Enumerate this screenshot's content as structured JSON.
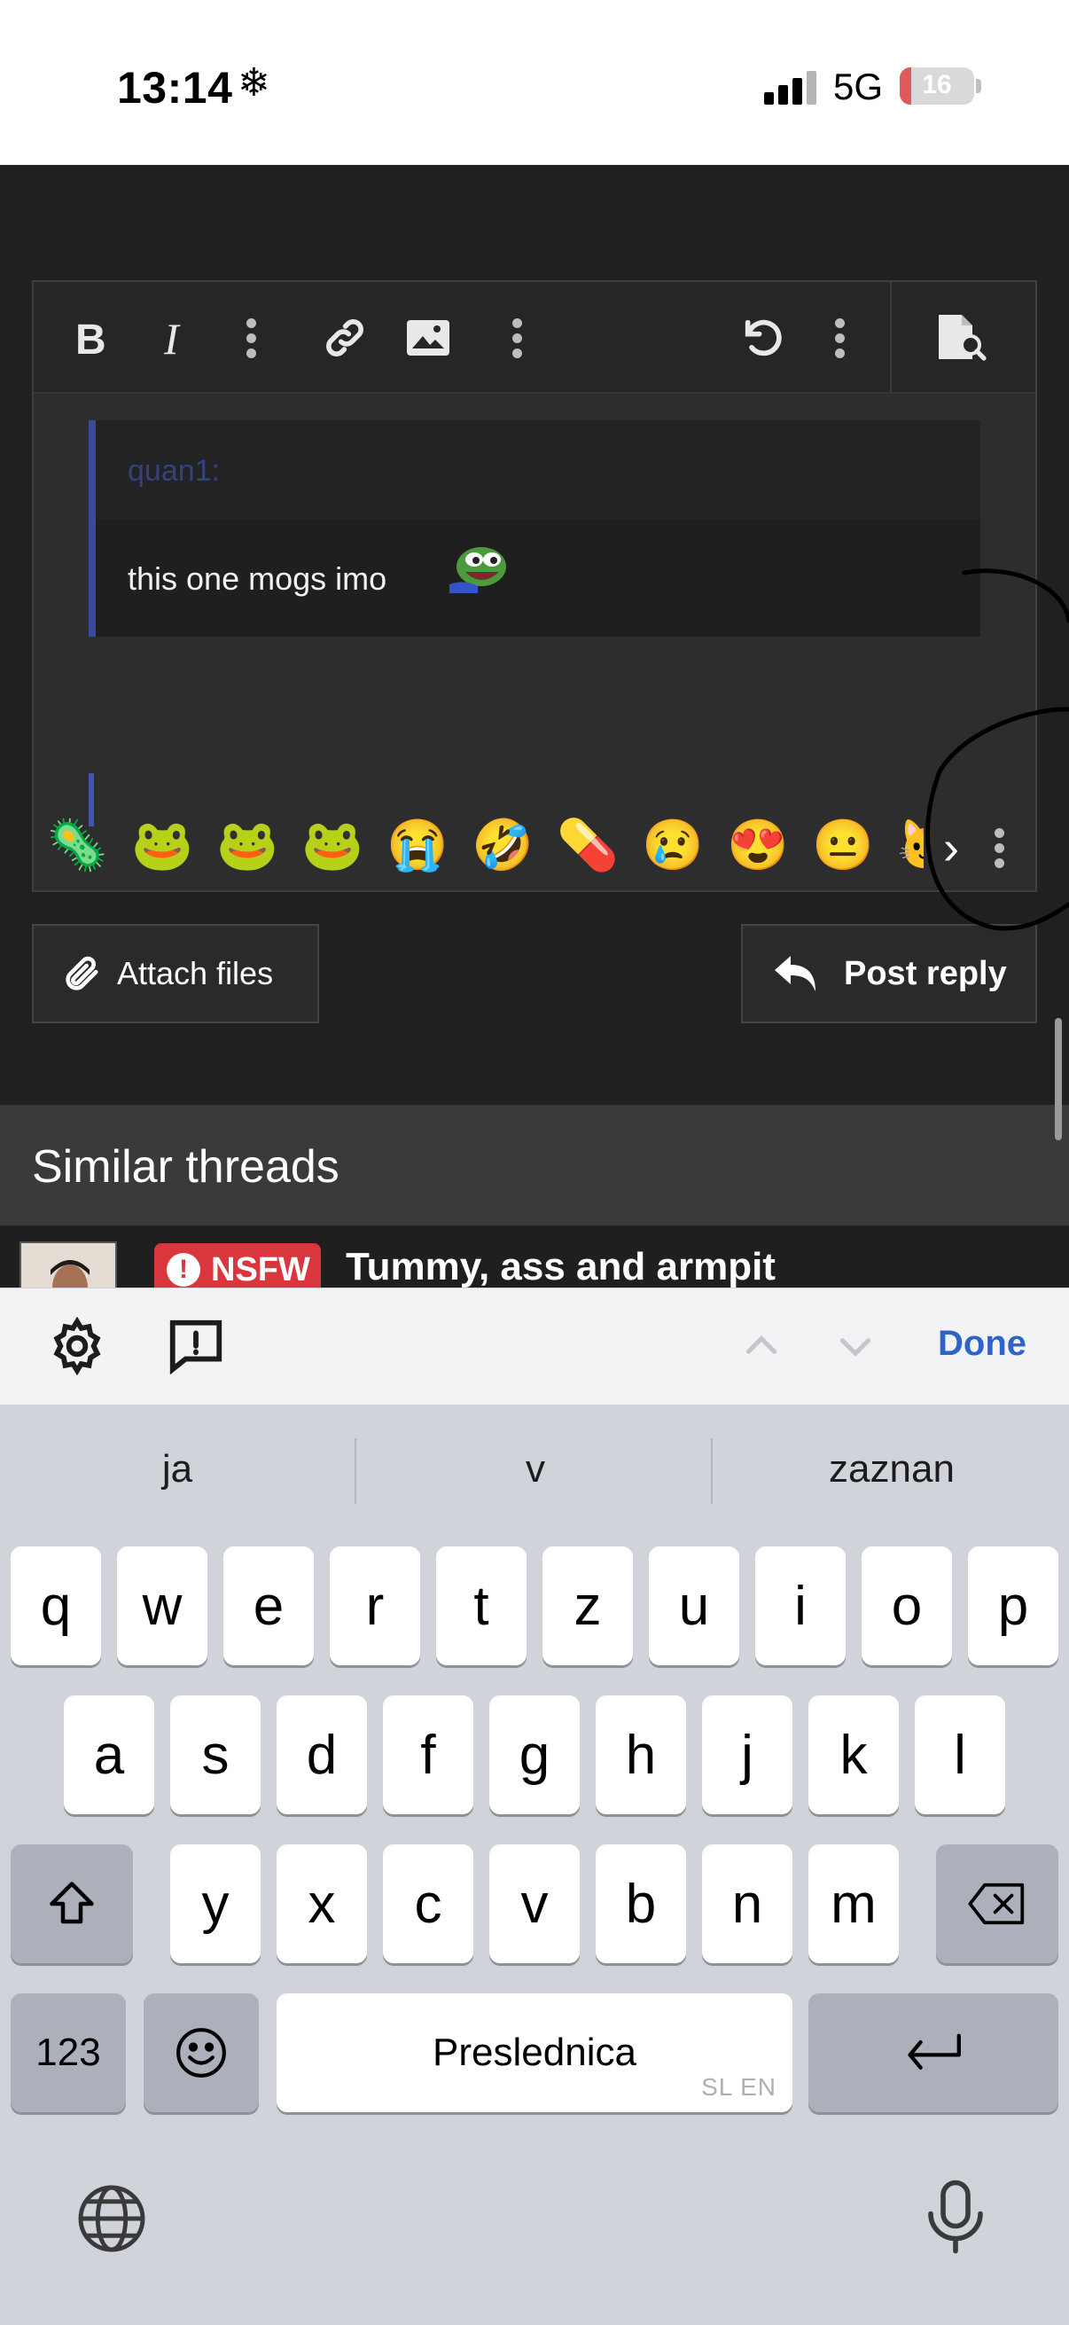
{
  "status_bar": {
    "time": "13:14",
    "time_icon": "snowflake-icon",
    "network": "5G",
    "battery": "16",
    "battery_level": 0.16
  },
  "editor": {
    "toolbar": {
      "bold_icon": "bold-icon",
      "italic_icon": "italic-icon",
      "more_icon": "more-vertical-icon",
      "link_icon": "link-icon",
      "image_icon": "image-icon",
      "undo_icon": "undo-icon",
      "preview_icon": "preview-icon"
    },
    "quote": {
      "author": "quan1:",
      "text": "this one mogs imo"
    },
    "emoji_bar": {
      "emojis": [
        "🦠",
        "🐸",
        "🐸",
        "🐸",
        "😭",
        "🤣",
        "💊",
        "😢",
        "😍",
        "😐",
        "🐱"
      ],
      "next_icon": "chevron-right-icon",
      "more_icon": "more-vertical-icon"
    }
  },
  "actions": {
    "attach_label": "Attach files",
    "post_label": "Post reply"
  },
  "similar": {
    "title": "Similar threads",
    "thread": {
      "badge": "NSFW",
      "title": "Tummy, ass and armpit"
    }
  },
  "keyboard_accessory": {
    "done_label": "Done"
  },
  "keyboard": {
    "predictions": [
      "ja",
      "v",
      "zaznan"
    ],
    "row1": [
      "q",
      "w",
      "e",
      "r",
      "t",
      "z",
      "u",
      "i",
      "o",
      "p"
    ],
    "row2": [
      "a",
      "s",
      "d",
      "f",
      "g",
      "h",
      "j",
      "k",
      "l"
    ],
    "row3": [
      "y",
      "x",
      "c",
      "v",
      "b",
      "n",
      "m"
    ],
    "numbers_label": "123",
    "space_label": "Preslednica",
    "language_label": "SL EN"
  },
  "colors": {
    "page_bg": "#202020",
    "quote_accent": "#3b4a98",
    "nsfw_badge": "#d9363e",
    "done_blue": "#2f63c8"
  }
}
